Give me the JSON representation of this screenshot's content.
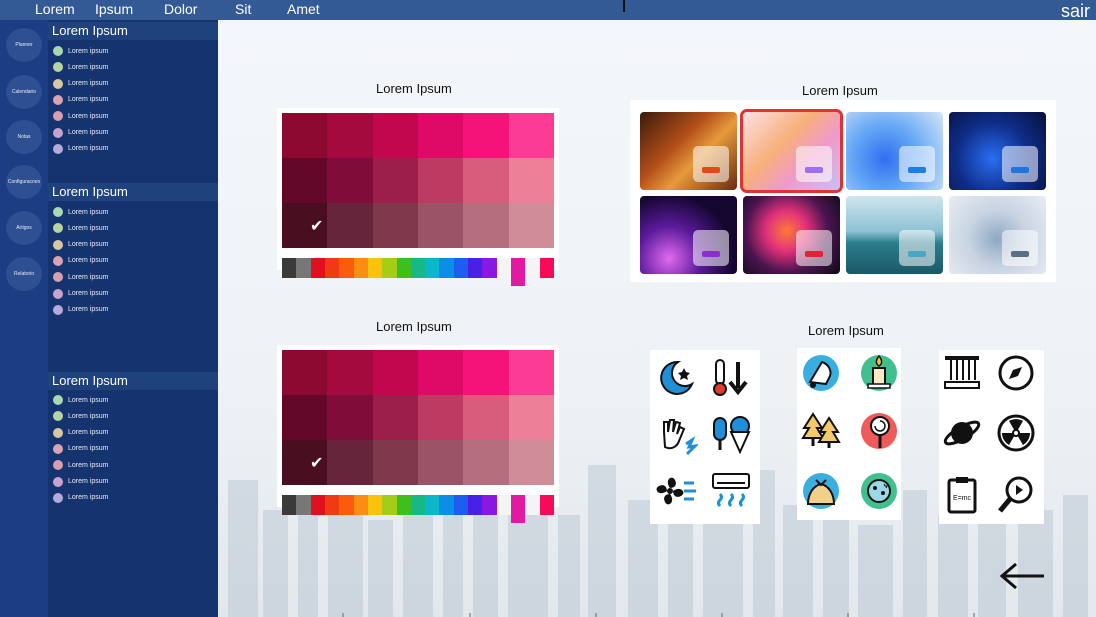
{
  "topbar": {
    "nav": [
      "Lorem",
      "Ipsum",
      "Dolor",
      "Sit",
      "Amet"
    ],
    "logout": "sair"
  },
  "rail": [
    "Planner",
    "Calendario",
    "Notas",
    "Configuracoes",
    "Artigos",
    "Relatorio"
  ],
  "panel": {
    "sections": [
      {
        "title": "Lorem Ipsum",
        "items": [
          "Lorem ipsum",
          "Lorem ipsum",
          "Lorem ipsum",
          "Lorem ipsum",
          "Lorem ipsum",
          "Lorem ipsum",
          "Lorem ipsum"
        ]
      },
      {
        "title": "Lorem Ipsum",
        "items": [
          "Lorem ipsum",
          "Lorem ipsum",
          "Lorem ipsum",
          "Lorem ipsum",
          "Lorem ipsum",
          "Lorem ipsum",
          "Lorem ipsum"
        ]
      },
      {
        "title": "Lorem Ipsum",
        "items": [
          "Lorem ipsum",
          "Lorem ipsum",
          "Lorem ipsum",
          "Lorem ipsum",
          "Lorem ipsum",
          "Lorem ipsum",
          "Lorem ipsum"
        ]
      }
    ],
    "dot_colors": [
      "#a9d8b0",
      "#b9d4a3",
      "#d8c7a3",
      "#d9a3b3",
      "#d79fb0",
      "#c9a3cf",
      "#b6a9dc"
    ]
  },
  "main": {
    "palette1_title": "Lorem Ipsum",
    "palette2_title": "Lorem Ipsum",
    "wallpapers_title": "Lorem Ipsum",
    "icons_title": "Lorem Ipsum"
  },
  "palette": {
    "rows": [
      [
        "#8c0a31",
        "#a50a3e",
        "#c2074e",
        "#df0a68",
        "#f5137a",
        "#fc3b95"
      ],
      [
        "#640829",
        "#800c3a",
        "#9c1f4b",
        "#bd3a63",
        "#d85c7b",
        "#ee7f98"
      ],
      [
        "#4a0e21",
        "#66253a",
        "#80394c",
        "#9a5465",
        "#b56e7e",
        "#cf8d9a"
      ]
    ],
    "check": "✔",
    "strip": [
      "#3a3a3a",
      "#777777",
      "#e0101f",
      "#f23a12",
      "#fb5b0a",
      "#fb8d10",
      "#f8c20d",
      "#a5cd16",
      "#3fbf1e",
      "#15b886",
      "#0ab8c9",
      "#0a8ee8",
      "#1d5ef0",
      "#4920e5",
      "#8b18e0",
      "#f4f4f4",
      "#e21aa2",
      "#f4f4f4",
      "#f70a58"
    ]
  },
  "wallpapers": [
    {
      "name": "autumn-forest",
      "chip": "#e04a1a"
    },
    {
      "name": "pastel-bloom",
      "chip": "#9b6ff0"
    },
    {
      "name": "blue-bloom-light",
      "chip": "#1e7ee8"
    },
    {
      "name": "blue-bloom-dark",
      "chip": "#1f74e0"
    },
    {
      "name": "purple-glow",
      "chip": "#8b2cd8"
    },
    {
      "name": "colorful-petals",
      "chip": "#e81e32"
    },
    {
      "name": "lake-landscape",
      "chip": "#4aa6c6"
    },
    {
      "name": "grey-bloom",
      "chip": "#5b6f86"
    }
  ],
  "icons": [
    "moon-stars-icon",
    "temperature-down-icon",
    "cold-hand-icon",
    "ice-cream-icon",
    "fan-wind-icon",
    "air-conditioner-icon",
    "bell-icon",
    "candle-icon",
    "pine-trees-icon",
    "lollipop-icon",
    "gift-bag-icon",
    "cookie-icon",
    "newtons-cradle-icon",
    "compass-icon",
    "planet-icon",
    "radiation-icon",
    "formula-clipboard-icon",
    "play-search-icon"
  ]
}
